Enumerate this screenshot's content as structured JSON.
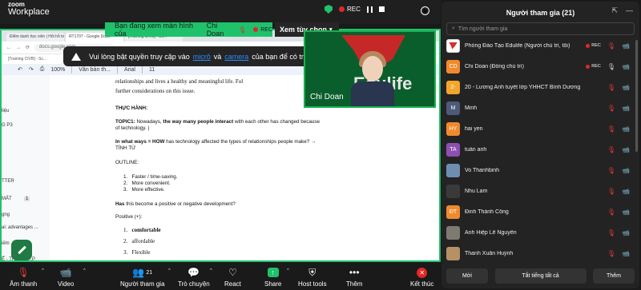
{
  "app": {
    "logo_line1": "zoom",
    "logo_line2": "Workplace"
  },
  "share_banner": {
    "text": "Bạn đang xem màn hình của",
    "presenter": "Chi Doan",
    "rec": "REC",
    "view_options": "Xem tùy chọn"
  },
  "top_status": {
    "rec": "REC"
  },
  "browser": {
    "tabs": [
      "Điểm danh học viên | Hỏi hỗ trợ",
      "RT1707 - Google Docs",
      "[Training CIVB] - Sc..."
    ],
    "url": "docs.google.com",
    "bookmarks": "[Training CIVB] - Sc..."
  },
  "doc_toolbar": {
    "zoom": "100%",
    "style": "Văn bản th...",
    "font": "Arial",
    "size": "11"
  },
  "outline": [
    "liệu",
    "G P3",
    "TTER",
    "MẤT",
    "gng",
    "ai: advantages ...",
    "iếm",
    "Ể - TRẢ LỜI...P"
  ],
  "outline_badge": "1",
  "document": {
    "line_a": "relationships and lives a healthy and meaningful life. Fol",
    "line_b": "further considerations on this issue.",
    "practice_heading": "THỰC HÀNH:",
    "topic_label": "TOPIC1:",
    "topic_text_1": " Nowadays, ",
    "topic_bold": "the way many people interact",
    "topic_text_2": " with each other has changed because",
    "topic_text_3": "of technology. |",
    "q_bold": "In what ways = HOW",
    "q_text": " has technology affected the types of relationships people make? →",
    "q_text_2": "TÍNH TỪ",
    "outline_label": "OUTLINE:",
    "list": [
      "Faster / time-saving.",
      "More convenient.",
      "More effective."
    ],
    "has_bold": "Has",
    "has_text": " this become a positive or negative development?",
    "positive": "Positive (+):",
    "serif_list": [
      "comfortable",
      "affordable",
      "Flexible"
    ]
  },
  "notice": {
    "text_1": "Vui lòng bật quyền truy cập vào",
    "mic": "micrô",
    "and": "và",
    "camera": "camera",
    "text_2": "của bạn để có trải nghiệm tốt nhất.",
    "close": "✕"
  },
  "video_tile": {
    "name": "Chi Doan",
    "bg_text": "Edulife"
  },
  "toolbar": {
    "audio": "Âm thanh",
    "video": "Video",
    "participants": "Người tham gia",
    "participants_count": "21",
    "chat": "Trò chuyện",
    "react": "React",
    "share": "Share",
    "host_tools": "Host tools",
    "more": "Thêm",
    "end": "Kết thúc"
  },
  "panel": {
    "title": "Người tham gia (21)",
    "search_placeholder": "Tìm người tham gia",
    "invite": "Mời",
    "mute_all": "Tắt tiếng tất cả",
    "more": "Thêm",
    "participants": [
      {
        "initials": "",
        "name": "Phòng Đào Tạo Edulife (Người chủ trì, tôi)",
        "color": "#ffffff",
        "rec": "REC"
      },
      {
        "initials": "CD",
        "name": "Chi Doan (Đồng chủ trì)",
        "color": "#f08a2c",
        "rec": "REC"
      },
      {
        "initials": "2-",
        "name": "20 - Lương Anh tuyết lớp YHHCT Bình Dương",
        "color": "#f2a62b",
        "rec": ""
      },
      {
        "initials": "M",
        "name": "Minh",
        "color": "#4d5a78",
        "rec": ""
      },
      {
        "initials": "HY",
        "name": "hai yen",
        "color": "#f08a2c",
        "rec": ""
      },
      {
        "initials": "TA",
        "name": "tuấn anh",
        "color": "#8d4fb0",
        "rec": ""
      },
      {
        "initials": "",
        "name": "Vo Thanhbinh",
        "color": "#6f8db1",
        "rec": ""
      },
      {
        "initials": "",
        "name": "Nhu Lam",
        "color": "#3a3a3a",
        "rec": ""
      },
      {
        "initials": "ĐT",
        "name": "Đinh Thành Công",
        "color": "#f08a2c",
        "rec": ""
      },
      {
        "initials": "",
        "name": "Anh Hiệp Lê Nguyễn",
        "color": "#7e7a72",
        "rec": ""
      },
      {
        "initials": "",
        "name": "Thanh Xuân Huỳnh",
        "color": "#b79163",
        "rec": ""
      }
    ]
  }
}
